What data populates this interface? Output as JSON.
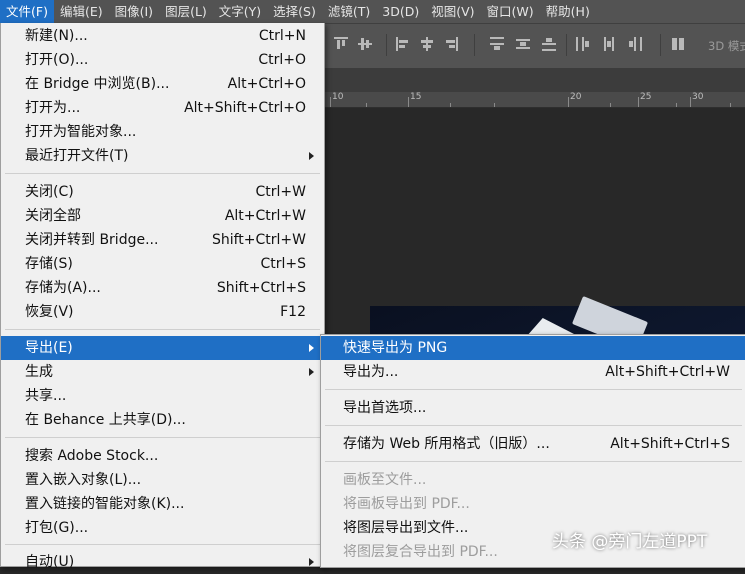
{
  "menubar": {
    "items": [
      {
        "label": "文件(F)"
      },
      {
        "label": "编辑(E)"
      },
      {
        "label": "图像(I)"
      },
      {
        "label": "图层(L)"
      },
      {
        "label": "文字(Y)"
      },
      {
        "label": "选择(S)"
      },
      {
        "label": "滤镜(T)"
      },
      {
        "label": "3D(D)"
      },
      {
        "label": "视图(V)"
      },
      {
        "label": "窗口(W)"
      },
      {
        "label": "帮助(H)"
      }
    ]
  },
  "options_bar": {
    "mode_3d": "3D 模式"
  },
  "ruler": {
    "labels": [
      "10",
      "15",
      "20",
      "25",
      "30"
    ]
  },
  "file_menu": {
    "items": [
      {
        "label": "新建(N)...",
        "shortcut": "Ctrl+N"
      },
      {
        "label": "打开(O)...",
        "shortcut": "Ctrl+O"
      },
      {
        "label": "在 Bridge 中浏览(B)...",
        "shortcut": "Alt+Ctrl+O"
      },
      {
        "label": "打开为...",
        "shortcut": "Alt+Shift+Ctrl+O"
      },
      {
        "label": "打开为智能对象...",
        "shortcut": ""
      },
      {
        "label": "最近打开文件(T)",
        "shortcut": ""
      },
      {
        "label": "关闭(C)",
        "shortcut": "Ctrl+W"
      },
      {
        "label": "关闭全部",
        "shortcut": "Alt+Ctrl+W"
      },
      {
        "label": "关闭并转到 Bridge...",
        "shortcut": "Shift+Ctrl+W"
      },
      {
        "label": "存储(S)",
        "shortcut": "Ctrl+S"
      },
      {
        "label": "存储为(A)...",
        "shortcut": "Shift+Ctrl+S"
      },
      {
        "label": "恢复(V)",
        "shortcut": "F12"
      },
      {
        "label": "导出(E)",
        "shortcut": ""
      },
      {
        "label": "生成",
        "shortcut": ""
      },
      {
        "label": "共享...",
        "shortcut": ""
      },
      {
        "label": "在 Behance 上共享(D)...",
        "shortcut": ""
      },
      {
        "label": "搜索 Adobe Stock...",
        "shortcut": ""
      },
      {
        "label": "置入嵌入对象(L)...",
        "shortcut": ""
      },
      {
        "label": "置入链接的智能对象(K)...",
        "shortcut": ""
      },
      {
        "label": "打包(G)...",
        "shortcut": ""
      },
      {
        "label": "自动(U)",
        "shortcut": ""
      }
    ]
  },
  "export_submenu": {
    "items": [
      {
        "label": "快速导出为 PNG",
        "shortcut": ""
      },
      {
        "label": "导出为...",
        "shortcut": "Alt+Shift+Ctrl+W"
      },
      {
        "label": "导出首选项...",
        "shortcut": ""
      },
      {
        "label": "存储为 Web 所用格式（旧版）...",
        "shortcut": "Alt+Shift+Ctrl+S"
      },
      {
        "label": "画板至文件...",
        "shortcut": ""
      },
      {
        "label": "将画板导出到 PDF...",
        "shortcut": ""
      },
      {
        "label": "将图层导出到文件...",
        "shortcut": ""
      },
      {
        "label": "将图层复合导出到 PDF...",
        "shortcut": ""
      }
    ]
  },
  "watermark": "头条 @旁门左道PPT",
  "colors": {
    "highlight": "#1f6fc5",
    "menu_bg": "#f0f0f0",
    "app_bg": "#535353"
  }
}
